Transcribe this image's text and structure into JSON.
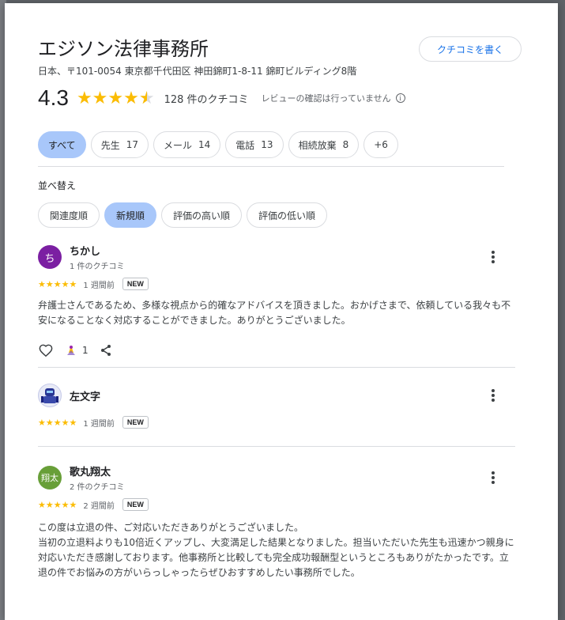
{
  "place": {
    "title": "エジソン法律事務所",
    "address": "日本、〒101-0054 東京都千代田区 神田錦町1-8-11 錦町ビルディング8階",
    "write_review_label": "クチコミを書く"
  },
  "summary": {
    "rating": "4.3",
    "rating_value": 4.3,
    "review_count": "128 件のクチコミ",
    "verify_note": "レビューの確認は行っていません",
    "info_icon": "ⓘ"
  },
  "filters": [
    {
      "label": "すべて",
      "count": "",
      "selected": true
    },
    {
      "label": "先生",
      "count": "17",
      "selected": false
    },
    {
      "label": "メール",
      "count": "14",
      "selected": false
    },
    {
      "label": "電話",
      "count": "13",
      "selected": false
    },
    {
      "label": "相続放棄",
      "count": "8",
      "selected": false
    },
    {
      "label": "+6",
      "count": "",
      "selected": false
    }
  ],
  "sort": {
    "label": "並べ替え",
    "options": [
      {
        "label": "関連度順",
        "selected": false
      },
      {
        "label": "新規順",
        "selected": true
      },
      {
        "label": "評価の高い順",
        "selected": false
      },
      {
        "label": "評価の低い順",
        "selected": false
      }
    ]
  },
  "reviews": [
    {
      "name": "ちかし",
      "avatar_text": "ち",
      "sub": "1 件のクチコミ",
      "stars": "★★★★★",
      "time": "1 週間前",
      "badge": "NEW",
      "body": "弁護士さんであるため、多様な視点から的確なアドバイスを頂きました。おかげさまで、依頼している我々も不安になることなく対応することができました。ありがとうございました。",
      "like_count": "1"
    },
    {
      "name": "左文字",
      "avatar_text": "",
      "sub": "",
      "stars": "★★★★★",
      "time": "1 週間前",
      "badge": "NEW"
    },
    {
      "name": "歌丸翔太",
      "avatar_text": "翔太",
      "sub": "2 件のクチコミ",
      "stars": "★★★★★",
      "time": "2 週間前",
      "badge": "NEW",
      "body_lines": [
        "この度は立退の件、ご対応いただきありがとうございました。",
        "当初の立退料よりも10倍近くアップし、大変満足した結果となりました。担当いただいた先生も迅速かつ親身に対応いただき感謝しております。他事務所と比較しても完全成功報酬型というところもありがたかったです。立退の件でお悩みの方がいらっしゃったらぜひおすすめしたい事務所でした。"
      ]
    }
  ],
  "colors": {
    "accent": "#1a73e8",
    "star": "#fbbc04",
    "chip_selected": "#a8c7fa"
  }
}
